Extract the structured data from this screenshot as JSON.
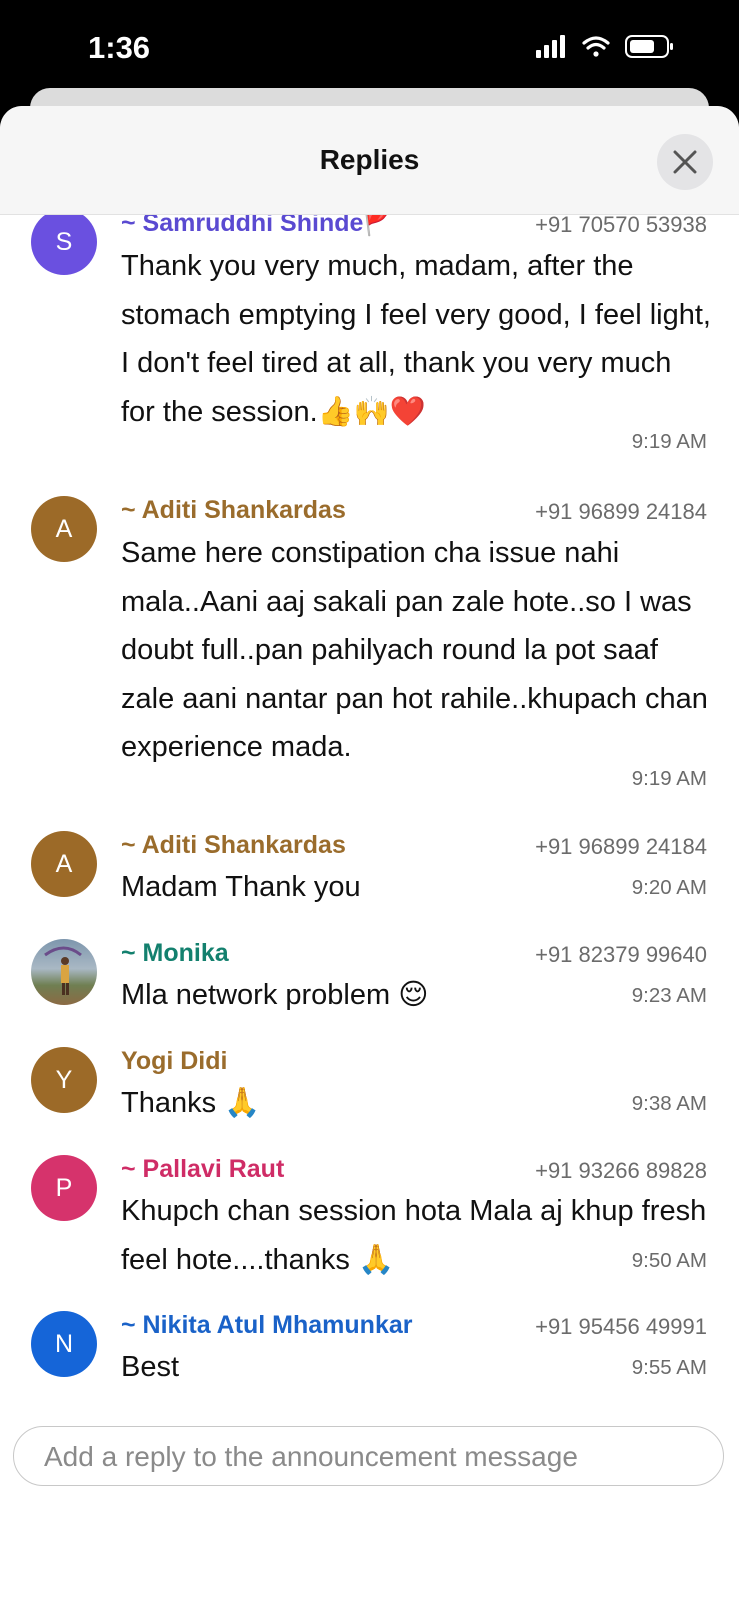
{
  "status_bar": {
    "time": "1:36"
  },
  "header": {
    "title": "Replies"
  },
  "messages": [
    {
      "avatar_letter": "S",
      "avatar_color": "#6a50e0",
      "name": "~ Samruddhi Shinde🚩",
      "name_color": "#5a4ad1",
      "phone": "+91 70570 53938",
      "text": "Thank you very much, madam, after the stomach emptying I feel very good, I feel light, I don't feel tired at all, thank you very much for the session.👍🙌❤️",
      "time": "9:19 AM"
    },
    {
      "avatar_letter": "A",
      "avatar_color": "#9c6a28",
      "name": "~ Aditi Shankardas",
      "name_color": "#9a6c2c",
      "phone": "+91 96899 24184",
      "text": "Same here constipation cha issue nahi mala..Aani aaj sakali pan zale hote..so I was doubt full..pan pahilyach round la pot  saaf zale aani nantar pan hot rahile..khupach chan experience mada.",
      "time": "9:19 AM"
    },
    {
      "avatar_letter": "A",
      "avatar_color": "#9c6a28",
      "name": "~ Aditi Shankardas",
      "name_color": "#9a6c2c",
      "phone": "+91 96899 24184",
      "text": "Madam Thank you",
      "time": "9:20 AM"
    },
    {
      "avatar_letter": "",
      "avatar_color": "#8fa3b8",
      "name": "~ Monika",
      "name_color": "#13806e",
      "phone": "+91 82379 99640",
      "text": "Mla network problem 😌",
      "time": "9:23 AM"
    },
    {
      "avatar_letter": "Y",
      "avatar_color": "#9c6a28",
      "name": "Yogi Didi",
      "name_color": "#9a6c2c",
      "phone": "",
      "text": "Thanks 🙏",
      "time": "9:38 AM"
    },
    {
      "avatar_letter": "P",
      "avatar_color": "#d6336c",
      "name": "~ Pallavi Raut",
      "name_color": "#cf2c66",
      "phone": "+91 93266 89828",
      "text": "Khupch chan session hota Mala aj khup fresh feel hote....thanks 🙏",
      "time": "9:50 AM"
    },
    {
      "avatar_letter": "N",
      "avatar_color": "#1565d8",
      "name": "~ Nikita Atul Mhamunkar",
      "name_color": "#1a62c8",
      "phone": "+91 95456 49991",
      "text": "Best",
      "time": "9:55 AM"
    }
  ],
  "reply_input": {
    "placeholder": "Add a reply to the announcement message"
  },
  "icons": [
    "signal-icon",
    "wifi-icon",
    "battery-icon",
    "close-icon"
  ]
}
